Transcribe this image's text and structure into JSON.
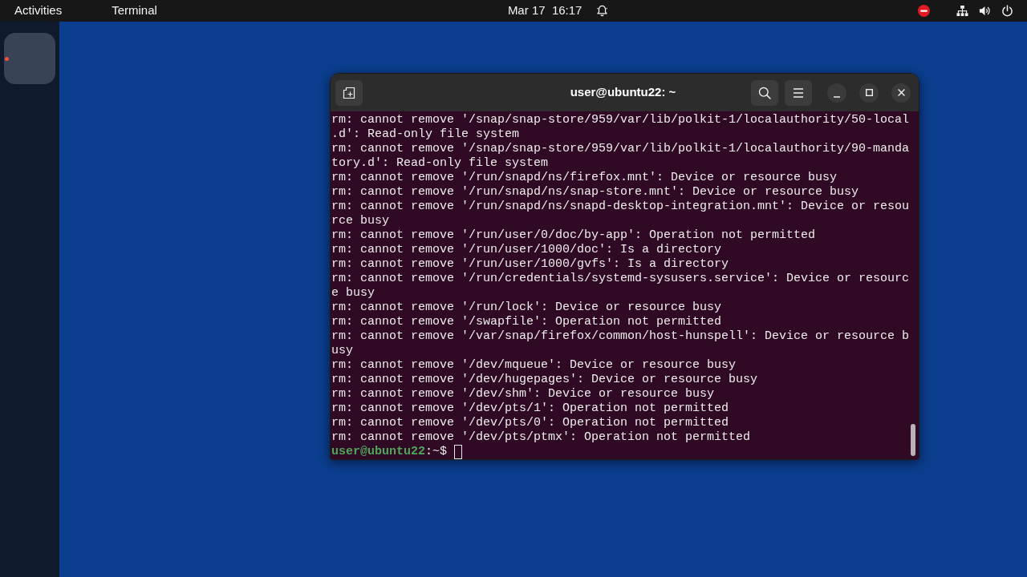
{
  "top_bar": {
    "activities": "Activities",
    "app_menu": "Terminal",
    "clock": "Mar 17  16:17"
  },
  "dock": {
    "items": [
      {
        "running": true
      }
    ]
  },
  "terminal": {
    "title": "user@ubuntu22: ~",
    "lines": [
      "rm: cannot remove '/snap/snap-store/959/var/lib/polkit-1/localauthority/50-local",
      ".d': Read-only file system",
      "rm: cannot remove '/snap/snap-store/959/var/lib/polkit-1/localauthority/90-manda",
      "tory.d': Read-only file system",
      "rm: cannot remove '/run/snapd/ns/firefox.mnt': Device or resource busy",
      "rm: cannot remove '/run/snapd/ns/snap-store.mnt': Device or resource busy",
      "rm: cannot remove '/run/snapd/ns/snapd-desktop-integration.mnt': Device or resou",
      "rce busy",
      "rm: cannot remove '/run/user/0/doc/by-app': Operation not permitted",
      "rm: cannot remove '/run/user/1000/doc': Is a directory",
      "rm: cannot remove '/run/user/1000/gvfs': Is a directory",
      "rm: cannot remove '/run/credentials/systemd-sysusers.service': Device or resourc",
      "e busy",
      "rm: cannot remove '/run/lock': Device or resource busy",
      "rm: cannot remove '/swapfile': Operation not permitted",
      "rm: cannot remove '/var/snap/firefox/common/host-hunspell': Device or resource b",
      "usy",
      "rm: cannot remove '/dev/mqueue': Device or resource busy",
      "rm: cannot remove '/dev/hugepages': Device or resource busy",
      "rm: cannot remove '/dev/shm': Device or resource busy",
      "rm: cannot remove '/dev/pts/1': Operation not permitted",
      "rm: cannot remove '/dev/pts/0': Operation not permitted",
      "rm: cannot remove '/dev/pts/ptmx': Operation not permitted"
    ],
    "prompt": {
      "user_host": "user@ubuntu22",
      "path": ":~$"
    }
  }
}
